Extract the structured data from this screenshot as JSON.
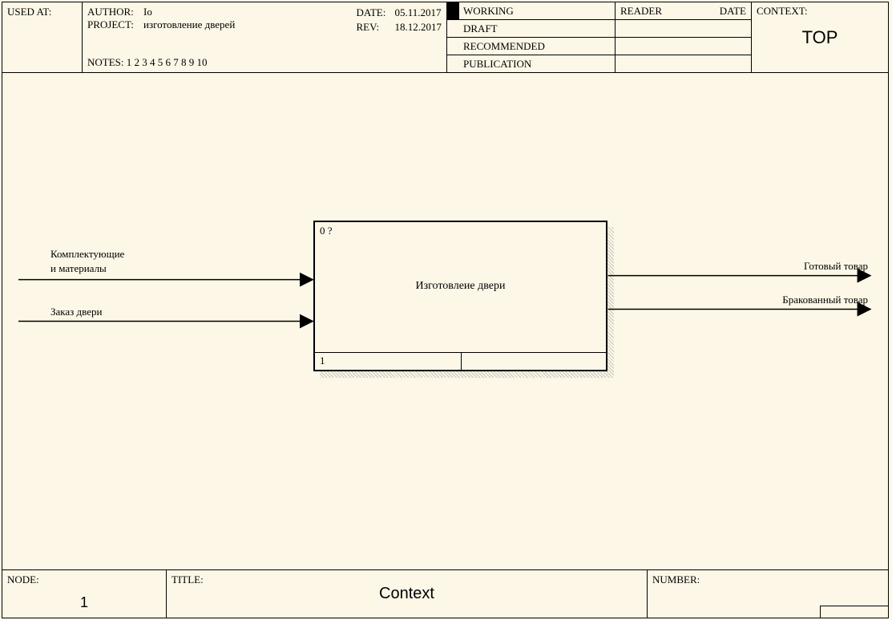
{
  "header": {
    "used_at_label": "USED AT:",
    "author_label": "AUTHOR:",
    "author": "Io",
    "project_label": "PROJECT:",
    "project": "изготовление дверей",
    "date_label": "DATE:",
    "date": "05.11.2017",
    "rev_label": "REV:",
    "rev": "18.12.2017",
    "notes_label": "NOTES:",
    "notes": "1  2  3  4  5  6  7  8  9  10",
    "status": {
      "working": "WORKING",
      "draft": "DRAFT",
      "recommended": "RECOMMENDED",
      "publication": "PUBLICATION"
    },
    "reader_label": "READER",
    "reader_date_label": "DATE",
    "context_label": "CONTEXT:",
    "context_value": "TOP"
  },
  "diagram": {
    "activity": {
      "top_id": "0 ?",
      "title": "Изготовлеие двери",
      "bottom_left": "1"
    },
    "inputs": [
      {
        "label_line1": "Комплектующие",
        "label_line2": "и материалы"
      },
      {
        "label_line1": "Заказ двери"
      }
    ],
    "outputs": [
      {
        "label": "Готовый товар"
      },
      {
        "label": "Бракованный товар"
      }
    ]
  },
  "footer": {
    "node_label": "NODE:",
    "node_value": "1",
    "title_label": "TITLE:",
    "title_value": "Context",
    "number_label": "NUMBER:"
  }
}
